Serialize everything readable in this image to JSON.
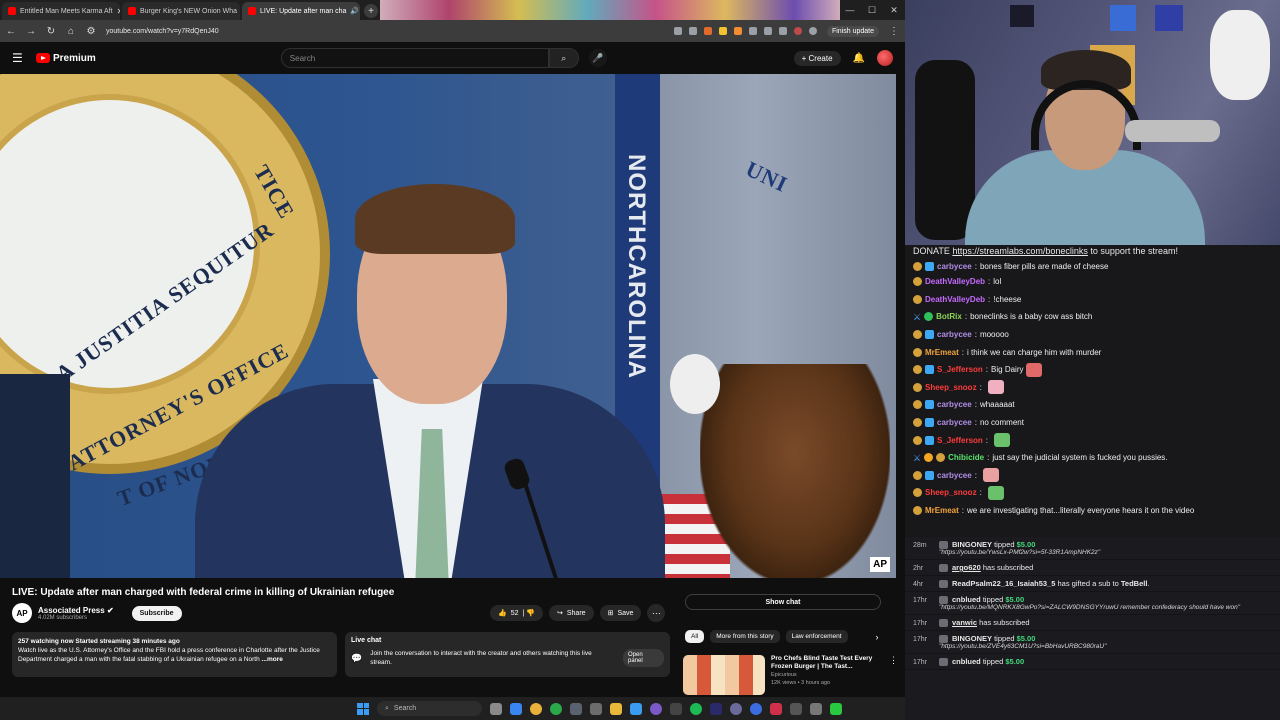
{
  "browser": {
    "tabs": [
      {
        "label": "Entitled Man Meets Karma Aft"
      },
      {
        "label": "Burger King's NEW Onion Wha"
      },
      {
        "label": "LIVE: Update after man cha"
      }
    ],
    "url": "youtube.com/watch?v=y7RdQenJ40",
    "finish_update": "Finish update"
  },
  "youtube": {
    "logo": "Premium",
    "search_placeholder": "Search",
    "create": "Create",
    "video": {
      "title": "LIVE: Update after man charged with federal crime in killing of Ukrainian refugee",
      "overlay_seal_1": "A JUSTITIA SEQUITUR",
      "overlay_seal_2": "ATTORNEY'S OFFICE",
      "overlay_seal_3": "T OF NORTH CAROLINA",
      "overlay_seal_4": "TICE",
      "overlay_flag": "NORTHCAROLINA",
      "overlay_flag_top": "UNI",
      "ap_logo": "AP"
    },
    "channel": {
      "name": "Associated Press",
      "subs": "4.02M subscribers",
      "subscribe": "Subscribe"
    },
    "actions": {
      "likes": "52",
      "share": "Share",
      "save": "Save"
    },
    "description": {
      "stats": "257 watching now  Started streaming 38 minutes ago",
      "text": "Watch live as the U.S. Attorney's Office and the FBI hold a press conference in Charlotte after the Justice Department charged a man with the fatal stabbing of a Ukrainian refugee on a North",
      "more": "...more"
    },
    "live_chat": {
      "title": "Live chat",
      "message": "Join the conversation to interact with the creator and others watching this live stream.",
      "open_panel": "Open panel"
    },
    "show_chat": "Show chat",
    "chips": [
      "All",
      "More from this story",
      "Law enforcement"
    ],
    "recommendation": {
      "title": "Pro Chefs Blind Taste Test Every Frozen Burger | The Tast...",
      "channel": "Epicurious",
      "meta": "12K views  •  3 hours ago"
    }
  },
  "stream_chat": {
    "donate_prefix": "DONATE ",
    "donate_link": "https://streamlabs.com/boneclinks",
    "donate_suffix": " to support the stream!",
    "messages": [
      {
        "user": "carbycee",
        "text": "bones fiber pills are made of cheese",
        "color": "#b18ee6"
      },
      {
        "user": "DeathValleyDeb",
        "text": "lol",
        "color": "#c66bff"
      },
      {
        "user": "DeathValleyDeb",
        "text": "!cheese",
        "color": "#c66bff"
      },
      {
        "user": "BotRix",
        "text": "boneclinks is a baby cow ass bitch",
        "color": "#8bd45a"
      },
      {
        "user": "carbycee",
        "text": "mooooo",
        "color": "#b18ee6"
      },
      {
        "user": "MrEmeat",
        "text": "i think we can charge him with murder",
        "color": "#f2a33a"
      },
      {
        "user": "S_Jefferson",
        "text": "Big Dairy",
        "color": "#ff3b3b"
      },
      {
        "user": "Sheep_snooz",
        "text": "",
        "color": "#ff3b3b"
      },
      {
        "user": "carbycee",
        "text": "whaaaaat",
        "color": "#b18ee6"
      },
      {
        "user": "carbycee",
        "text": "no comment",
        "color": "#b18ee6"
      },
      {
        "user": "S_Jefferson",
        "text": "",
        "color": "#ff3b3b"
      },
      {
        "user": "Chibicide",
        "text": "just say the judicial system is fucked you pussies.",
        "color": "#57e36b"
      },
      {
        "user": "carbycee",
        "text": "",
        "color": "#b18ee6"
      },
      {
        "user": "Sheep_snooz",
        "text": "",
        "color": "#ff3b3b"
      },
      {
        "user": "MrEmeat",
        "text": "we are investigating that...literally everyone hears it on the video",
        "color": "#f2a33a"
      }
    ]
  },
  "events": [
    {
      "time": "28m",
      "user": "BINGONEY",
      "action": " tipped ",
      "amount": "$5.00",
      "note": "\"https://youtu.be/YwsLx-PMf2w?si=5f-33R1AmpNHK2z\""
    },
    {
      "time": "2hr",
      "user": "argo620",
      "action": " has subscribed",
      "amount": "",
      "note": ""
    },
    {
      "time": "4hr",
      "user": "ReadPsalm22_16_Isaiah53_5",
      "action": " has gifted a sub to ",
      "amount": "",
      "target": "TedBell",
      "note": ""
    },
    {
      "time": "17hr",
      "user": "cnblued",
      "action": " tipped ",
      "amount": "$5.00",
      "note": "\"https://youtu.be/MQNRKX8GwPo?si=ZALCW9DNSGYYruwU remember confederacy should have won\""
    },
    {
      "time": "17hr",
      "user": "vanwic",
      "action": " has subscribed",
      "amount": "",
      "note": ""
    },
    {
      "time": "17hr",
      "user": "BINGONEY",
      "action": " tipped ",
      "amount": "$5.00",
      "note": "\"https://youtu.be/ZVE4y63CM1U?si=BbHavURBC980raU\""
    },
    {
      "time": "17hr",
      "user": "cnblued",
      "action": " tipped ",
      "amount": "$5.00",
      "note": ""
    }
  ],
  "taskbar": {
    "search": "Search"
  },
  "colors": {
    "youtube_red": "#ff0000",
    "chat_bg": "#18181b",
    "tip_green": "#42d97c"
  }
}
